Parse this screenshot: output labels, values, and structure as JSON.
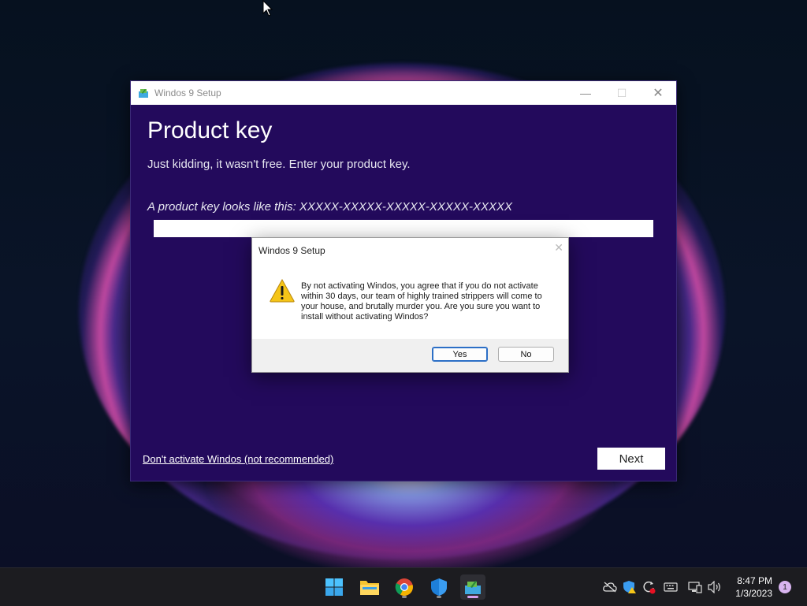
{
  "setup_window": {
    "title": "Windos 9 Setup",
    "heading": "Product key",
    "subheading": "Just kidding, it wasn't free. Enter your product key.",
    "hint": "A product key looks like this: XXXXX-XXXXX-XXXXX-XXXXX-XXXXX",
    "product_key_value": "",
    "skip_link": "Don't activate Windos (not recommended)",
    "next_label": "Next"
  },
  "dialog": {
    "title": "Windos 9 Setup",
    "message": "By not activating Windos, you agree that if you do not activate within 30 days, our team of highly trained strippers will come to your house, and brutally murder you. Are you sure you want to install without activating Windos?",
    "yes_label": "Yes",
    "no_label": "No",
    "icon": "warning-icon"
  },
  "taskbar": {
    "apps": [
      "start-icon",
      "file-explorer-icon",
      "chrome-icon",
      "defender-icon",
      "windos-setup-icon"
    ],
    "time": "8:47 PM",
    "date": "1/3/2023",
    "notification_count": "1"
  },
  "colors": {
    "setup_bg": "#230a5c",
    "accent": "#2c6fc6",
    "warning": "#f5c518"
  }
}
